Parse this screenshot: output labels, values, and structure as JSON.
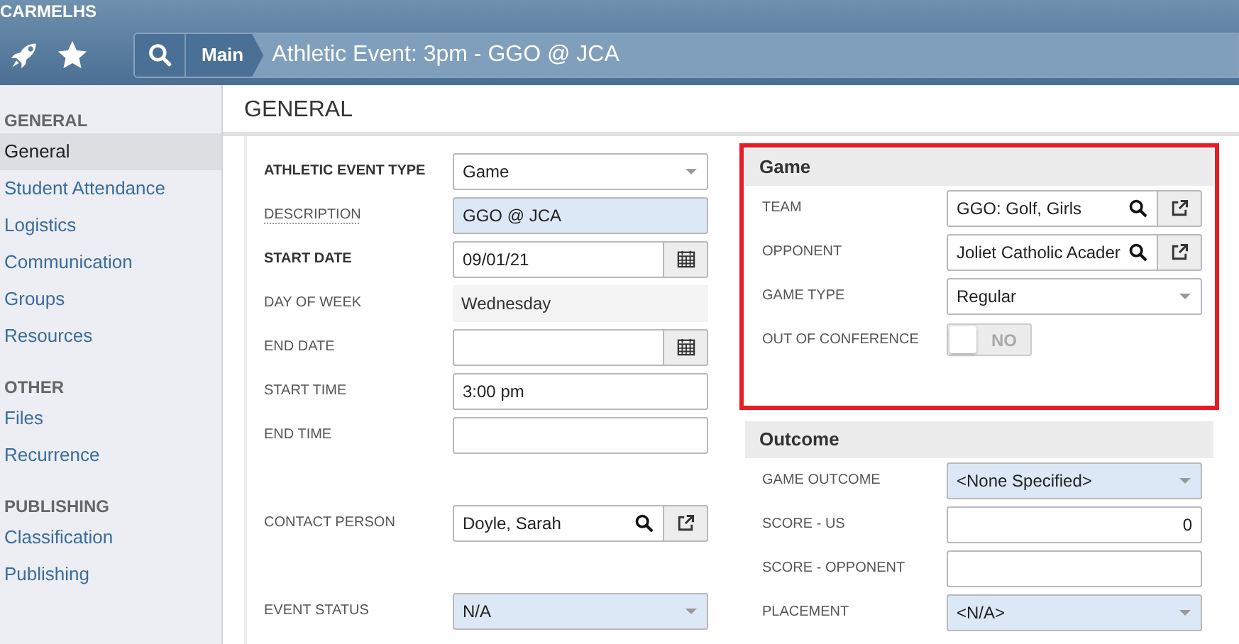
{
  "app": {
    "name": "CARMELHS"
  },
  "breadcrumb": {
    "items": [
      "Main"
    ],
    "title": "Athletic Event: 3pm - GGO @ JCA"
  },
  "sidebar": [
    {
      "heading": "GENERAL",
      "items": [
        {
          "label": "General",
          "selected": true
        },
        {
          "label": "Student Attendance",
          "selected": false
        },
        {
          "label": "Logistics",
          "selected": false
        },
        {
          "label": "Communication",
          "selected": false
        },
        {
          "label": "Groups",
          "selected": false
        },
        {
          "label": "Resources",
          "selected": false
        }
      ]
    },
    {
      "heading": "OTHER",
      "items": [
        {
          "label": "Files",
          "selected": false
        },
        {
          "label": "Recurrence",
          "selected": false
        }
      ]
    },
    {
      "heading": "PUBLISHING",
      "items": [
        {
          "label": "Classification",
          "selected": false
        },
        {
          "label": "Publishing",
          "selected": false
        }
      ]
    }
  ],
  "page_title": "GENERAL",
  "form": [
    {
      "label": "ATHLETIC EVENT TYPE",
      "required": true,
      "kind": "select",
      "value": "Game",
      "highlight": false
    },
    {
      "label": "DESCRIPTION",
      "tooltip": true,
      "kind": "text",
      "value": "GGO @ JCA",
      "highlight": true
    },
    {
      "label": "START DATE",
      "required": true,
      "kind": "date",
      "value": "09/01/21",
      "highlight": false
    },
    {
      "label": "DAY OF WEEK",
      "kind": "readonly",
      "value": "Wednesday"
    },
    {
      "label": "END DATE",
      "kind": "date",
      "highlight": false
    },
    {
      "label": "START TIME",
      "kind": "text",
      "value": "3:00 pm",
      "highlight": false
    },
    {
      "label": "END TIME",
      "kind": "text",
      "highlight": false
    },
    {
      "label": "CONTACT PERSON",
      "kind": "lookup",
      "value": "Doyle, Sarah"
    },
    {
      "label": "EVENT STATUS",
      "kind": "select",
      "value": "N/A",
      "highlight": true
    }
  ],
  "panels": [
    {
      "title": "Game",
      "outlined": true,
      "fields": [
        {
          "label": "TEAM",
          "kind": "lookup",
          "value": "GGO: Golf, Girls"
        },
        {
          "label": "OPPONENT",
          "kind": "lookup",
          "value": "Joliet Catholic Acader"
        },
        {
          "label": "GAME TYPE",
          "kind": "select",
          "value": "Regular",
          "highlight": false
        },
        {
          "label": "OUT OF CONFERENCE",
          "kind": "toggle",
          "on": false,
          "text": "NO"
        }
      ]
    },
    {
      "title": "Outcome",
      "outlined": false,
      "fields": [
        {
          "label": "GAME OUTCOME",
          "kind": "select",
          "value": "<None Specified>",
          "highlight": true
        },
        {
          "label": "SCORE - US",
          "kind": "number",
          "value": "0"
        },
        {
          "label": "SCORE - OPPONENT",
          "kind": "number"
        },
        {
          "label": "PLACEMENT",
          "kind": "select",
          "value": "<N/A>",
          "highlight": true
        }
      ]
    }
  ]
}
